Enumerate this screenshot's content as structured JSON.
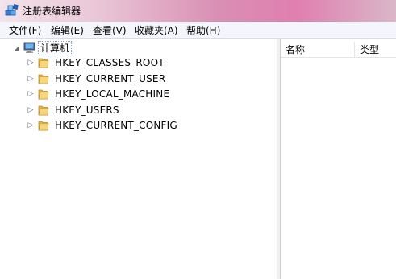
{
  "window": {
    "title": "注册表编辑器",
    "icon": "registry-editor-icon"
  },
  "menu": [
    {
      "label": "文件(F)"
    },
    {
      "label": "编辑(E)"
    },
    {
      "label": "查看(V)"
    },
    {
      "label": "收藏夹(A)"
    },
    {
      "label": "帮助(H)"
    }
  ],
  "tree": {
    "root": {
      "label": "计算机",
      "icon": "computer-icon",
      "expanded": true
    },
    "keys": [
      {
        "label": "HKEY_CLASSES_ROOT",
        "icon": "folder-icon"
      },
      {
        "label": "HKEY_CURRENT_USER",
        "icon": "folder-icon"
      },
      {
        "label": "HKEY_LOCAL_MACHINE",
        "icon": "folder-icon"
      },
      {
        "label": "HKEY_USERS",
        "icon": "folder-icon"
      },
      {
        "label": "HKEY_CURRENT_CONFIG",
        "icon": "folder-icon"
      }
    ]
  },
  "list": {
    "columns": [
      {
        "label": "名称"
      },
      {
        "label": "类型"
      }
    ]
  },
  "colors": {
    "folder": "#e8b84a",
    "selection_border": "#7da2ce"
  }
}
